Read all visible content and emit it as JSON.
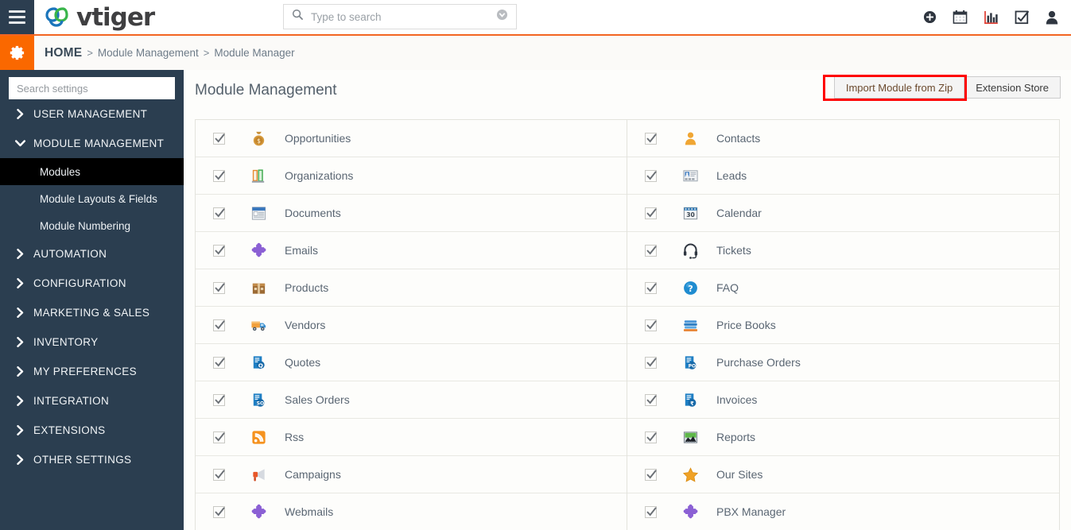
{
  "app": {
    "brand_name": "vtiger",
    "hamburger_icon": "hamburger-menu-icon",
    "gear_icon": "gear-icon",
    "accent_orange": "#fa6800",
    "sidebar_navy": "#2b3e50",
    "highlight_red": "#ff0000"
  },
  "search": {
    "placeholder": "Type to search",
    "value": "",
    "icon": "search-icon",
    "caret_icon": "chevron-down-circle-icon"
  },
  "topbar_icons": [
    {
      "name": "add-circle-icon",
      "label": "Add"
    },
    {
      "name": "calendar-icon",
      "label": "Calendar"
    },
    {
      "name": "bar-chart-icon",
      "label": "Reports"
    },
    {
      "name": "checkbox-task-icon",
      "label": "Tasks"
    },
    {
      "name": "user-profile-icon",
      "label": "Profile"
    }
  ],
  "breadcrumb": {
    "home": "HOME",
    "separator": ">",
    "items": [
      "Module Management",
      "Module Manager"
    ]
  },
  "sidebar": {
    "search_placeholder": "Search settings",
    "search_value": "",
    "groups": [
      {
        "label": "USER MANAGEMENT",
        "expanded": false,
        "icon": "chevron-right-icon"
      },
      {
        "label": "MODULE MANAGEMENT",
        "expanded": true,
        "icon": "chevron-down-icon",
        "children": [
          {
            "label": "Modules",
            "active": true
          },
          {
            "label": "Module Layouts & Fields",
            "active": false
          },
          {
            "label": "Module Numbering",
            "active": false
          }
        ]
      },
      {
        "label": "AUTOMATION",
        "expanded": false,
        "icon": "chevron-right-icon"
      },
      {
        "label": "CONFIGURATION",
        "expanded": false,
        "icon": "chevron-right-icon"
      },
      {
        "label": "MARKETING & SALES",
        "expanded": false,
        "icon": "chevron-right-icon"
      },
      {
        "label": "INVENTORY",
        "expanded": false,
        "icon": "chevron-right-icon"
      },
      {
        "label": "MY PREFERENCES",
        "expanded": false,
        "icon": "chevron-right-icon"
      },
      {
        "label": "INTEGRATION",
        "expanded": false,
        "icon": "chevron-right-icon"
      },
      {
        "label": "EXTENSIONS",
        "expanded": false,
        "icon": "chevron-right-icon"
      },
      {
        "label": "OTHER SETTINGS",
        "expanded": false,
        "icon": "chevron-right-icon"
      }
    ]
  },
  "main": {
    "title": "Module Management",
    "buttons": [
      {
        "label": "Import Module from Zip",
        "highlighted": true
      },
      {
        "label": "Extension Store",
        "highlighted": false
      }
    ],
    "modules_left": [
      {
        "label": "Opportunities",
        "checked": true,
        "icon": "money-bag-icon"
      },
      {
        "label": "Organizations",
        "checked": true,
        "icon": "books-organizations-icon"
      },
      {
        "label": "Documents",
        "checked": true,
        "icon": "document-icon"
      },
      {
        "label": "Emails",
        "checked": true,
        "icon": "puzzle-piece-icon"
      },
      {
        "label": "Products",
        "checked": true,
        "icon": "box-package-icon"
      },
      {
        "label": "Vendors",
        "checked": true,
        "icon": "delivery-truck-icon"
      },
      {
        "label": "Quotes",
        "checked": true,
        "icon": "quote-document-icon"
      },
      {
        "label": "Sales Orders",
        "checked": true,
        "icon": "sales-order-document-icon"
      },
      {
        "label": "Rss",
        "checked": true,
        "icon": "rss-feed-icon"
      },
      {
        "label": "Campaigns",
        "checked": true,
        "icon": "megaphone-icon"
      },
      {
        "label": "Webmails",
        "checked": true,
        "icon": "puzzle-piece-icon"
      }
    ],
    "modules_right": [
      {
        "label": "Contacts",
        "checked": true,
        "icon": "person-contact-icon"
      },
      {
        "label": "Leads",
        "checked": true,
        "icon": "id-card-icon"
      },
      {
        "label": "Calendar",
        "checked": true,
        "icon": "calendar-30-icon"
      },
      {
        "label": "Tickets",
        "checked": true,
        "icon": "headset-icon"
      },
      {
        "label": "FAQ",
        "checked": true,
        "icon": "question-mark-circle-icon"
      },
      {
        "label": "Price Books",
        "checked": true,
        "icon": "stacked-books-icon"
      },
      {
        "label": "Purchase Orders",
        "checked": true,
        "icon": "purchase-order-document-icon"
      },
      {
        "label": "Invoices",
        "checked": true,
        "icon": "invoice-document-icon"
      },
      {
        "label": "Reports",
        "checked": true,
        "icon": "chart-image-icon"
      },
      {
        "label": "Our Sites",
        "checked": true,
        "icon": "star-icon"
      },
      {
        "label": "PBX Manager",
        "checked": true,
        "icon": "puzzle-piece-icon"
      }
    ]
  }
}
